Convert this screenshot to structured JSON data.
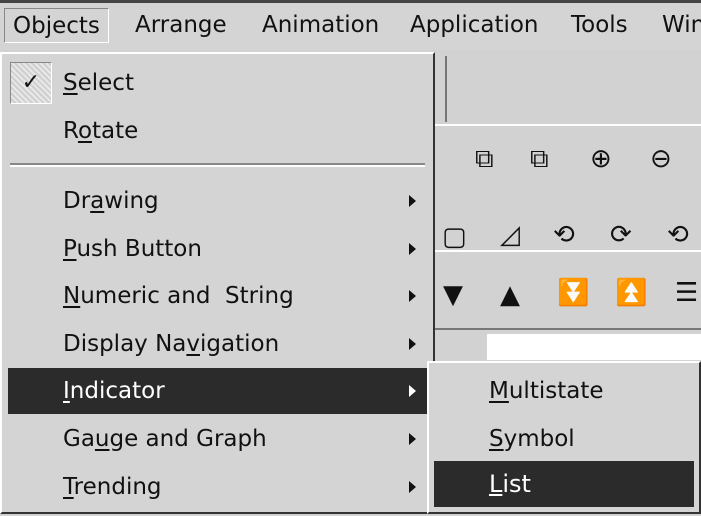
{
  "menubar": {
    "items": [
      {
        "label": "Objects",
        "open": true
      },
      {
        "label": "Arrange"
      },
      {
        "label": "Animation"
      },
      {
        "label": "Application"
      },
      {
        "label": "Tools"
      },
      {
        "label": "Win"
      }
    ]
  },
  "objects_menu": {
    "items": [
      {
        "label": "Select",
        "mnemonic_index": 0,
        "checked": true
      },
      {
        "label": "Rotate",
        "mnemonic_index": 1
      },
      {
        "label": "Drawing",
        "mnemonic_index": 2,
        "submenu": true
      },
      {
        "label": "Push Button",
        "mnemonic_index": 0,
        "submenu": true
      },
      {
        "label": "Numeric and  String",
        "mnemonic_index": 0,
        "submenu": true
      },
      {
        "label": "Display Navigation",
        "mnemonic_index": 10,
        "submenu": true
      },
      {
        "label": "Indicator",
        "mnemonic_index": 0,
        "submenu": true,
        "highlighted": true
      },
      {
        "label": "Gauge and Graph",
        "mnemonic_index": 2,
        "submenu": true
      },
      {
        "label": "Trending",
        "mnemonic_index": 0,
        "submenu": true
      }
    ],
    "check_glyph": "✓"
  },
  "indicator_submenu": {
    "items": [
      {
        "label": "Multistate",
        "mnemonic_index": 0
      },
      {
        "label": "Symbol",
        "mnemonic_index": 0
      },
      {
        "label": "List",
        "mnemonic_index": 0,
        "highlighted": true
      }
    ]
  },
  "toolbar_icons": [
    "bring-forward-icon",
    "send-backward-icon",
    "zoom-in-icon",
    "zoom-out-icon",
    "rounded-rectangle-icon",
    "chord-icon",
    "loop-icon",
    "loop-branch-icon",
    "loop-target-icon",
    "triangle-down-icon",
    "triangle-up-icon",
    "double-down-icon",
    "double-up-icon",
    "list-icon"
  ],
  "colors": {
    "menu_bg": "#d4d4d4",
    "highlight": "#2b2b2b"
  }
}
